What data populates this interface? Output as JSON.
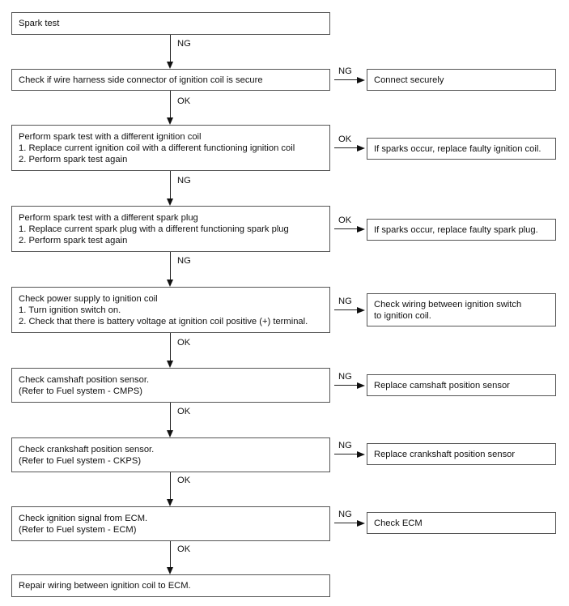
{
  "flowchart": {
    "main_steps": [
      {
        "lines": [
          "Spark test"
        ],
        "next_label": "NG"
      },
      {
        "lines": [
          "Check if wire harness side connector of ignition coil is secure"
        ],
        "next_label": "OK",
        "branch_label": "NG"
      },
      {
        "lines": [
          "Perform spark test with a different ignition coil",
          "1. Replace current ignition coil with a different functioning ignition coil",
          "2. Perform spark test again"
        ],
        "next_label": "NG",
        "branch_label": "OK"
      },
      {
        "lines": [
          "Perform spark test with a different spark plug",
          "1. Replace current spark plug with a different functioning spark plug",
          "2. Perform spark test again"
        ],
        "next_label": "NG",
        "branch_label": "OK"
      },
      {
        "lines": [
          "Check power supply to ignition coil",
          "1. Turn ignition switch on.",
          "2. Check that there is battery voltage at ignition coil positive (+) terminal."
        ],
        "next_label": "OK",
        "branch_label": "NG"
      },
      {
        "lines": [
          "Check camshaft position sensor.",
          "(Refer to Fuel system - CMPS)"
        ],
        "next_label": "OK",
        "branch_label": "NG"
      },
      {
        "lines": [
          "Check crankshaft position sensor.",
          "(Refer to Fuel system - CKPS)"
        ],
        "next_label": "OK",
        "branch_label": "NG"
      },
      {
        "lines": [
          "Check ignition signal from ECM.",
          "(Refer to Fuel system - ECM)"
        ],
        "next_label": "OK",
        "branch_label": "NG"
      },
      {
        "lines": [
          "Repair wiring between ignition coil to ECM."
        ]
      }
    ],
    "side_results": [
      {
        "lines": [
          "Connect securely"
        ]
      },
      {
        "lines": [
          "If sparks occur, replace faulty ignition coil."
        ]
      },
      {
        "lines": [
          "If sparks occur, replace faulty spark plug."
        ]
      },
      {
        "lines": [
          "Check wiring between ignition switch",
          "to ignition coil."
        ]
      },
      {
        "lines": [
          "Replace camshaft position sensor"
        ]
      },
      {
        "lines": [
          "Replace crankshaft position sensor"
        ]
      },
      {
        "lines": [
          "Check ECM"
        ]
      }
    ]
  }
}
